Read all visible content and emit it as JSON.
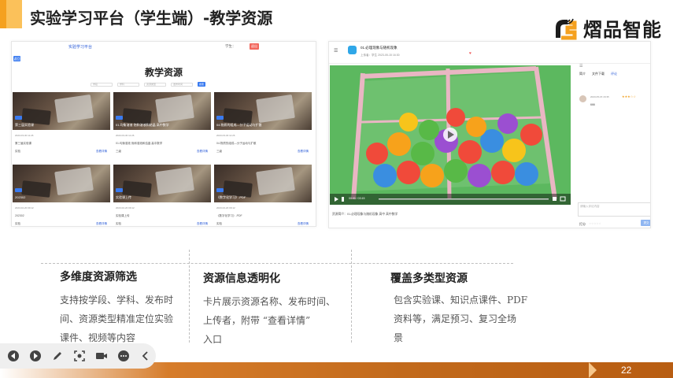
{
  "slide": {
    "title": "实验学习平台（学生端）-教学资源",
    "logo_text": "熠品智能",
    "page_number": "22"
  },
  "left_screenshot": {
    "brand": "实验学习平台",
    "user": "学生：",
    "logout": "退出",
    "back": "返回",
    "page_title": "教学资源",
    "filters": [
      "学段",
      "学科",
      "资源类型",
      "发布时间",
      "搜索"
    ],
    "cards": [
      {
        "name": "第三届实验课",
        "meta": "2023-03-30 11:26",
        "desc": "第三届实验课",
        "footer": "实验",
        "detail": "查看详情"
      },
      {
        "name": "01.均衡溶液 饱和溶液和结晶 高中数学",
        "meta": "2023-03-30 11:26",
        "desc": "01.均衡溶液 饱和溶液和结晶 高中数学",
        "footer": "三级",
        "detail": "查看详情"
      },
      {
        "name": "04.物质的组成—分子运动与扩散",
        "meta": "2023-03-30 11:26",
        "desc": "04.物质的组成—分子运动与扩散",
        "footer": "三级",
        "detail": "查看详情"
      },
      {
        "name": "202302",
        "meta": "2023-02-20 09:12",
        "desc": "202302",
        "footer": "实验",
        "detail": "查看详情"
      },
      {
        "name": "实验课上传",
        "meta": "2023-02-20 09:12",
        "desc": "实验课上传",
        "footer": "实验",
        "detail": "查看详情"
      },
      {
        "name": "《数字化学习》-PDF",
        "meta": "2023-02-20 09:12",
        "desc": "《数字化学习》-PDF",
        "footer": "实验",
        "detail": "查看详情"
      }
    ]
  },
  "right_screenshot": {
    "video_title": "01.必理现象与随机现象",
    "video_meta": "上传者：学生    2023-05-15 16:30",
    "caption": "资源简介：01.必理现象与随机现象 高中 高中数学",
    "time": "00:00 / 03:15",
    "side_tabs": [
      "简介",
      "文件下载",
      "评论"
    ],
    "comment_user": "2023-05-15 16:35",
    "comment_stars": "★★★☆☆",
    "comment_text": "666",
    "comment_placeholder": "请输入评论内容",
    "rate_label": "打分",
    "rate_stars": "☆☆☆☆☆",
    "submit": "提交"
  },
  "features": [
    {
      "title": "多维度资源筛选",
      "body": [
        "支持按学段、学科、发布时",
        "间、资源类型精准定位实验",
        "课件、视频等内容"
      ]
    },
    {
      "title": "资源信息透明化",
      "body": [
        "卡片展示资源名称、发布时间、",
        "上传者，附带 “查看详情”",
        "入口"
      ]
    },
    {
      "title": "覆盖多类型资源",
      "body": [
        "包含实验课、知识点课件、PDF",
        "资料等，满足预习、复习全场",
        "景"
      ]
    }
  ],
  "colors": {
    "accent": "#f5a11f",
    "footer": "#c26a1c",
    "link": "#2a5bd7",
    "button": "#3a7bf0"
  },
  "toolbar": {
    "icons": [
      "prev-icon",
      "next-icon",
      "pen-icon",
      "screenshot-icon",
      "camera-icon",
      "more-icon",
      "collapse-icon"
    ]
  }
}
